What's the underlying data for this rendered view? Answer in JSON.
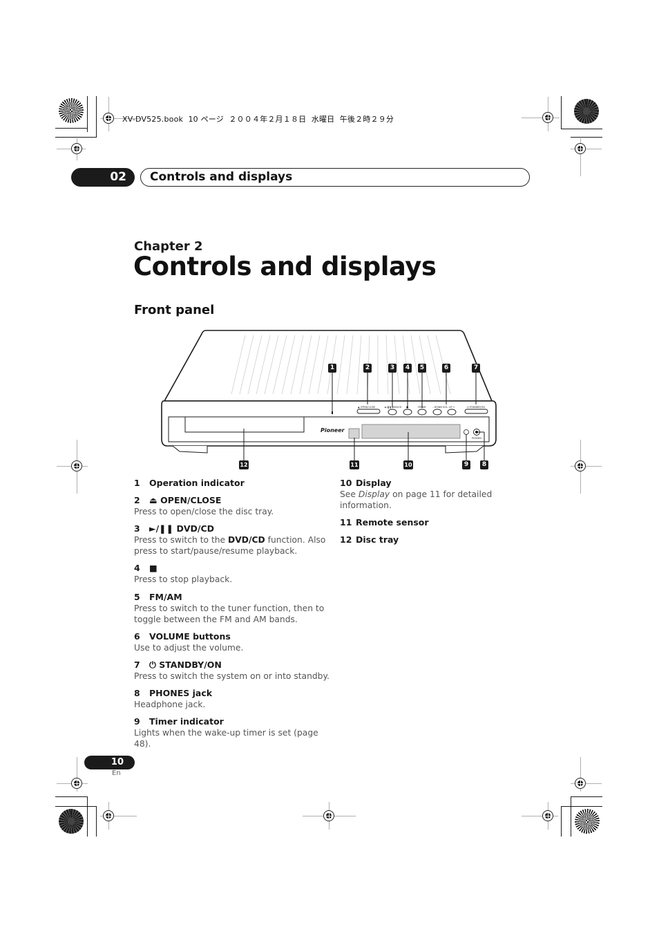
{
  "slug": "XV-DV525.book  10 ページ  ２００４年２月１８日  水曜日  午後２時２９分",
  "header": {
    "chapter_number": "02",
    "chapter_title": "Controls and displays"
  },
  "chapter": {
    "label": "Chapter 2",
    "title": "Controls and displays"
  },
  "section": {
    "title": "Front panel"
  },
  "diagram": {
    "brand_logo": "Pioneer",
    "top_callouts": [
      "1",
      "2",
      "3",
      "4",
      "5",
      "6",
      "7"
    ],
    "bottom_callouts": [
      "12",
      "11",
      "10",
      "9",
      "8"
    ],
    "button_labels": {
      "open_close": "▲ OPEN/CLOSE",
      "dvd_cd": "►/❚❚ DVD/CD",
      "stop": "■",
      "fm_am": "FM/AM",
      "vol_down": "– DOWN",
      "vol": "VOL.",
      "vol_up": "UP +",
      "standby": "⏻ STANDBY/ON",
      "phones": "PHONES"
    }
  },
  "items_left": [
    {
      "num": "1",
      "icon": "",
      "title": "Operation indicator",
      "desc": ""
    },
    {
      "num": "2",
      "icon": "eject-icon",
      "title": "OPEN/CLOSE",
      "desc": "Press to open/close the disc tray."
    },
    {
      "num": "3",
      "icon": "play-pause-icon",
      "title": "DVD/CD",
      "desc_pre": "Press to switch to the ",
      "desc_bold": "DVD/CD",
      "desc_post": " function. Also press to start/pause/resume playback."
    },
    {
      "num": "4",
      "icon": "stop-icon",
      "title": "",
      "desc": "Press to stop playback."
    },
    {
      "num": "5",
      "icon": "",
      "title": "FM/AM",
      "desc": "Press to switch to the tuner function, then to toggle between the FM and AM bands."
    },
    {
      "num": "6",
      "icon": "",
      "title": "VOLUME buttons",
      "desc": "Use to adjust the volume."
    },
    {
      "num": "7",
      "icon": "power-icon",
      "title": "STANDBY/ON",
      "desc": "Press to switch the system on or into standby."
    },
    {
      "num": "8",
      "icon": "",
      "title": "PHONES jack",
      "desc": "Headphone jack."
    },
    {
      "num": "9",
      "icon": "",
      "title": "Timer indicator",
      "desc": "Lights when the wake-up timer is set (page 48)."
    }
  ],
  "items_right": [
    {
      "num": "10",
      "title": "Display",
      "desc_pre": "See ",
      "desc_italic": "Display",
      "desc_post": " on page 11 for detailed information."
    },
    {
      "num": "11",
      "title": "Remote sensor",
      "desc": ""
    },
    {
      "num": "12",
      "title": "Disc tray",
      "desc": ""
    }
  ],
  "footer": {
    "page_number": "10",
    "language": "En"
  },
  "icons": {
    "eject": "⏏",
    "play_pause": "►/❚❚",
    "stop": "■",
    "power": "⏻"
  }
}
